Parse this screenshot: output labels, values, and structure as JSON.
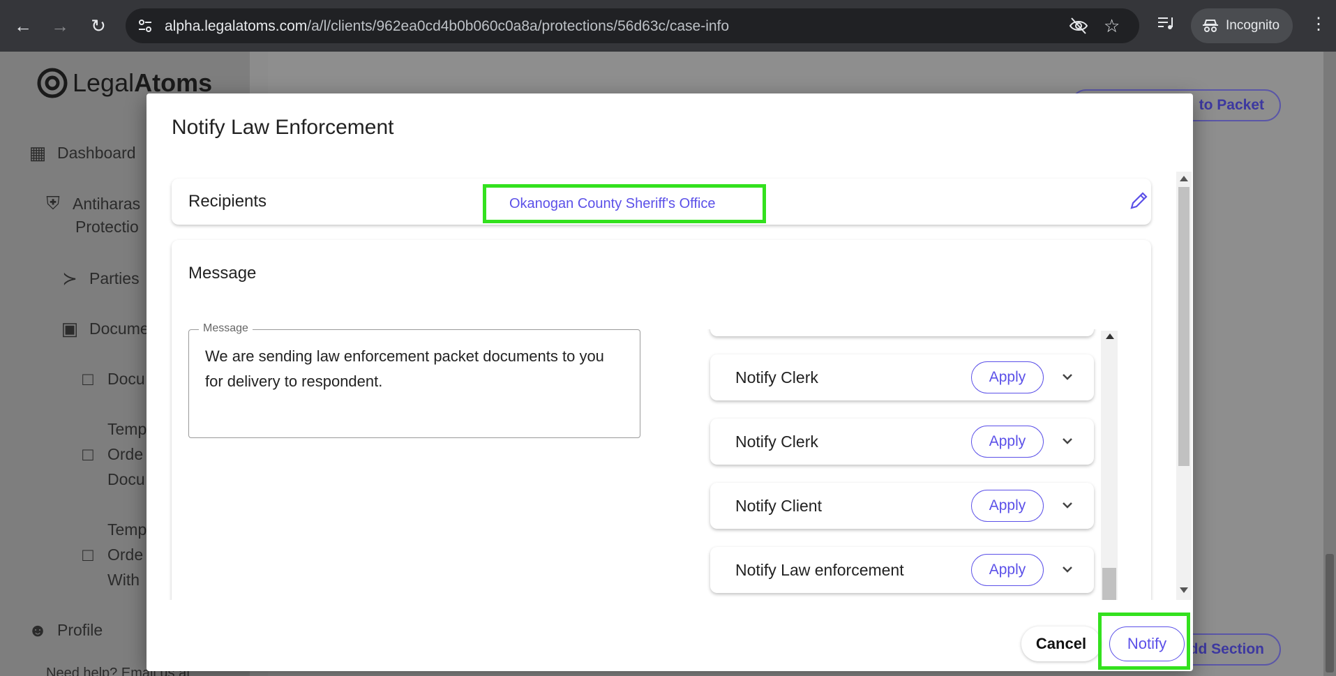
{
  "browser": {
    "url_host": "alpha.legalatoms.com",
    "url_path": "/a/l/clients/962ea0cd4b0b060c0a8a/protections/56d63c/case-info",
    "incognito_label": "Incognito"
  },
  "sidebar": {
    "logo_light": "Legal",
    "logo_bold": "Atoms",
    "items": [
      {
        "label": "Dashboard",
        "icon": "grid-icon"
      },
      {
        "label": "Antiharas",
        "icon": "shield-icon"
      },
      {
        "label": "Protectio",
        "icon": ""
      },
      {
        "label": "Parties",
        "icon": "share-icon"
      },
      {
        "label": "Docume",
        "icon": "archive-icon"
      },
      {
        "label": "Docu",
        "icon": "document-icon"
      },
      {
        "label": "Temp",
        "icon": "document-icon"
      },
      {
        "label": "Orde",
        "icon": ""
      },
      {
        "label": "Docu",
        "icon": ""
      },
      {
        "label": "Temp",
        "icon": "document-icon"
      },
      {
        "label": "Orde",
        "icon": ""
      },
      {
        "label": "With",
        "icon": ""
      },
      {
        "label": "Profile",
        "icon": "person-icon"
      }
    ],
    "need_help": "Need help? Email us at"
  },
  "background": {
    "packet_button": "to Packet",
    "section_button": "dd Section"
  },
  "modal": {
    "title": "Notify Law Enforcement",
    "recipients_label": "Recipients",
    "recipient_value": "Okanogan County Sheriff's Office",
    "message_heading": "Message",
    "message_field_label": "Message",
    "message_text": "We are sending law enforcement packet documents to you for delivery to respondent.",
    "templates": [
      {
        "name": "Notify Clerk",
        "apply": "Apply"
      },
      {
        "name": "Notify Clerk",
        "apply": "Apply"
      },
      {
        "name": "Notify Client",
        "apply": "Apply"
      },
      {
        "name": "Notify Law enforcement",
        "apply": "Apply"
      }
    ],
    "cancel_label": "Cancel",
    "notify_label": "Notify"
  },
  "colors": {
    "accent": "#5b50e8",
    "highlight": "#33e11e",
    "chrome": "#35363a"
  }
}
